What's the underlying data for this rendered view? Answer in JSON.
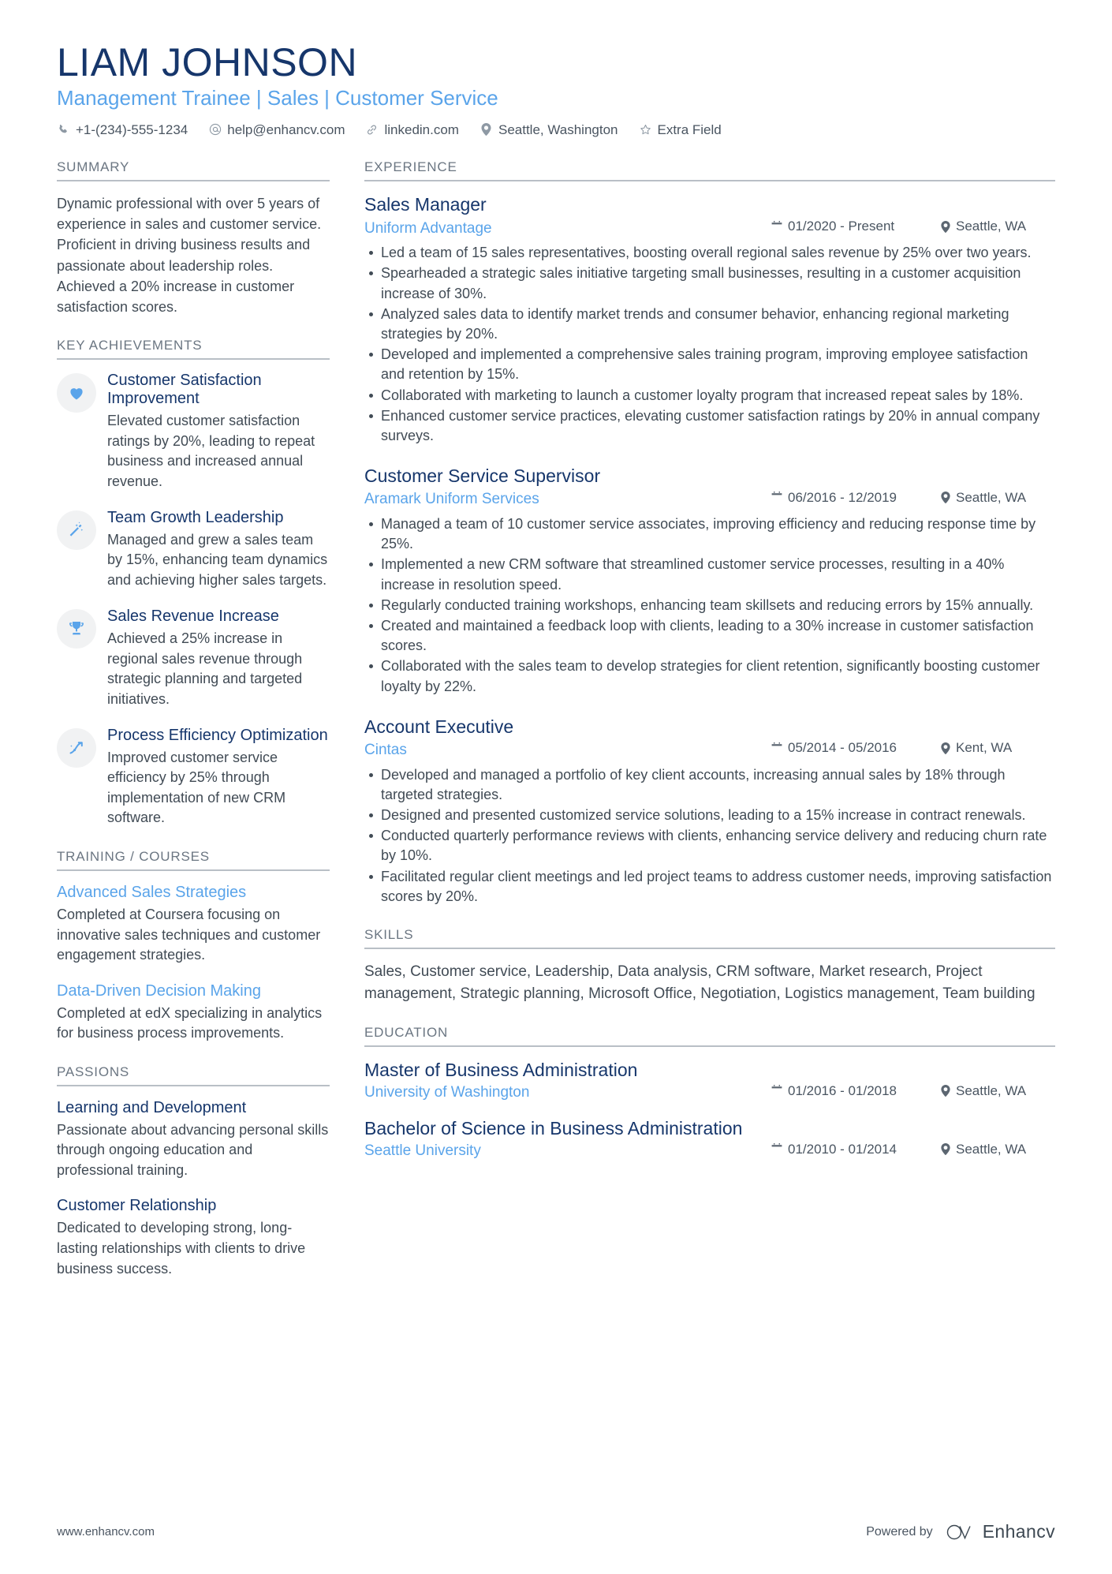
{
  "header": {
    "name": "LIAM JOHNSON",
    "headline": "Management Trainee | Sales | Customer Service",
    "contacts": [
      {
        "icon": "phone-icon",
        "text": "+1-(234)-555-1234"
      },
      {
        "icon": "email-icon",
        "text": "help@enhancv.com"
      },
      {
        "icon": "link-icon",
        "text": "linkedin.com"
      },
      {
        "icon": "location-pin-icon",
        "text": "Seattle, Washington"
      },
      {
        "icon": "star-icon",
        "text": "Extra Field"
      }
    ]
  },
  "colors": {
    "navy": "#16366b",
    "light_blue": "#5aa4ea",
    "body_text": "#414b55",
    "section_label": "#6b7682",
    "rule": "#b9bfc6",
    "icon_circle_bg": "#f1f2f3"
  },
  "left": {
    "summary": {
      "title": "SUMMARY",
      "text": "Dynamic professional with over 5 years of experience in sales and customer service. Proficient in driving business results and passionate about leadership roles. Achieved a 20% increase in customer satisfaction scores."
    },
    "key_achievements": {
      "title": "KEY ACHIEVEMENTS",
      "items": [
        {
          "icon": "heart-icon",
          "title": "Customer Satisfaction Improvement",
          "desc": "Elevated customer satisfaction ratings by 20%, leading to repeat business and increased annual revenue."
        },
        {
          "icon": "magic-wand-icon",
          "title": "Team Growth Leadership",
          "desc": "Managed and grew a sales team by 15%, enhancing team dynamics and achieving higher sales targets."
        },
        {
          "icon": "trophy-icon",
          "title": "Sales Revenue Increase",
          "desc": "Achieved a 25% increase in regional sales revenue through strategic planning and targeted initiatives."
        },
        {
          "icon": "growth-arrow-icon",
          "title": "Process Efficiency Optimization",
          "desc": "Improved customer service efficiency by 25% through implementation of new CRM software."
        }
      ]
    },
    "training": {
      "title": "TRAINING / COURSES",
      "items": [
        {
          "title": "Advanced Sales Strategies",
          "desc": "Completed at Coursera focusing on innovative sales techniques and customer engagement strategies."
        },
        {
          "title": "Data-Driven Decision Making",
          "desc": "Completed at edX specializing in analytics for business process improvements."
        }
      ]
    },
    "passions": {
      "title": "PASSIONS",
      "items": [
        {
          "title": "Learning and Development",
          "desc": "Passionate about advancing personal skills through ongoing education and professional training."
        },
        {
          "title": "Customer Relationship",
          "desc": "Dedicated to developing strong, long-lasting relationships with clients to drive business success."
        }
      ]
    }
  },
  "right": {
    "experience": {
      "title": "EXPERIENCE",
      "jobs": [
        {
          "title": "Sales Manager",
          "company": "Uniform Advantage",
          "date": "01/2020 - Present",
          "location": "Seattle, WA",
          "bullets": [
            "Led a team of 15 sales representatives, boosting overall regional sales revenue by 25% over two years.",
            "Spearheaded a strategic sales initiative targeting small businesses, resulting in a customer acquisition increase of 30%.",
            "Analyzed sales data to identify market trends and consumer behavior, enhancing regional marketing strategies by 20%.",
            "Developed and implemented a comprehensive sales training program, improving employee satisfaction and retention by 15%.",
            "Collaborated with marketing to launch a customer loyalty program that increased repeat sales by 18%.",
            "Enhanced customer service practices, elevating customer satisfaction ratings by 20% in annual company surveys."
          ]
        },
        {
          "title": "Customer Service Supervisor",
          "company": "Aramark Uniform Services",
          "date": "06/2016 - 12/2019",
          "location": "Seattle, WA",
          "bullets": [
            "Managed a team of 10 customer service associates, improving efficiency and reducing response time by 25%.",
            "Implemented a new CRM software that streamlined customer service processes, resulting in a 40% increase in resolution speed.",
            "Regularly conducted training workshops, enhancing team skillsets and reducing errors by 15% annually.",
            "Created and maintained a feedback loop with clients, leading to a 30% increase in customer satisfaction scores.",
            "Collaborated with the sales team to develop strategies for client retention, significantly boosting customer loyalty by 22%."
          ]
        },
        {
          "title": "Account Executive",
          "company": "Cintas",
          "date": "05/2014 - 05/2016",
          "location": "Kent, WA",
          "bullets": [
            "Developed and managed a portfolio of key client accounts, increasing annual sales by 18% through targeted strategies.",
            "Designed and presented customized service solutions, leading to a 15% increase in contract renewals.",
            "Conducted quarterly performance reviews with clients, enhancing service delivery and reducing churn rate by 10%.",
            "Facilitated regular client meetings and led project teams to address customer needs, improving satisfaction scores by 20%."
          ]
        }
      ]
    },
    "skills": {
      "title": "SKILLS",
      "text": "Sales, Customer service, Leadership, Data analysis, CRM software, Market research, Project management, Strategic planning, Microsoft Office, Negotiation, Logistics management, Team building"
    },
    "education": {
      "title": "EDUCATION",
      "items": [
        {
          "degree": "Master of Business Administration",
          "school": "University of Washington",
          "date": "01/2016 - 01/2018",
          "location": "Seattle, WA"
        },
        {
          "degree": "Bachelor of Science in Business Administration",
          "school": "Seattle University",
          "date": "01/2010 - 01/2014",
          "location": "Seattle, WA"
        }
      ]
    }
  },
  "footer": {
    "url": "www.enhancv.com",
    "powered_by": "Powered by",
    "brand": "Enhancv"
  }
}
